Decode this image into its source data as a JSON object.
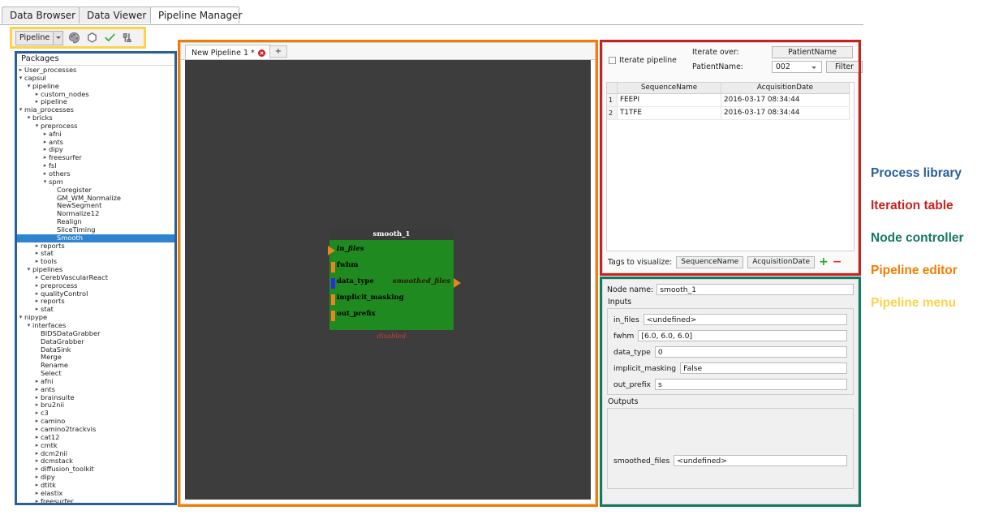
{
  "window": {
    "main_tabs": [
      {
        "label": "Data Browser",
        "active": false
      },
      {
        "label": "Data Viewer",
        "active": false
      },
      {
        "label": "Pipeline Manager",
        "active": true
      }
    ]
  },
  "pipeline_menu": {
    "combo_label": "Pipeline",
    "icons": [
      "palette-icon",
      "node-hexagon-icon",
      "checkmark-icon",
      "initialize-tool-icon"
    ]
  },
  "process_library": {
    "header": "Packages",
    "tree": [
      {
        "label": "User_processes",
        "depth": 0,
        "twisty": "collapsed"
      },
      {
        "label": "capsul",
        "depth": 0,
        "twisty": "expanded"
      },
      {
        "label": "pipeline",
        "depth": 1,
        "twisty": "expanded"
      },
      {
        "label": "custom_nodes",
        "depth": 2,
        "twisty": "collapsed"
      },
      {
        "label": "pipeline",
        "depth": 2,
        "twisty": "collapsed"
      },
      {
        "label": "mia_processes",
        "depth": 0,
        "twisty": "expanded"
      },
      {
        "label": "bricks",
        "depth": 1,
        "twisty": "expanded"
      },
      {
        "label": "preprocess",
        "depth": 2,
        "twisty": "expanded"
      },
      {
        "label": "afni",
        "depth": 3,
        "twisty": "collapsed"
      },
      {
        "label": "ants",
        "depth": 3,
        "twisty": "collapsed"
      },
      {
        "label": "dipy",
        "depth": 3,
        "twisty": "collapsed"
      },
      {
        "label": "freesurfer",
        "depth": 3,
        "twisty": "collapsed"
      },
      {
        "label": "fsl",
        "depth": 3,
        "twisty": "collapsed"
      },
      {
        "label": "others",
        "depth": 3,
        "twisty": "collapsed"
      },
      {
        "label": "spm",
        "depth": 3,
        "twisty": "expanded"
      },
      {
        "label": "Coregister",
        "depth": 4,
        "twisty": "none"
      },
      {
        "label": "GM_WM_Normalize",
        "depth": 4,
        "twisty": "none"
      },
      {
        "label": "NewSegment",
        "depth": 4,
        "twisty": "none"
      },
      {
        "label": "Normalize12",
        "depth": 4,
        "twisty": "none"
      },
      {
        "label": "Realign",
        "depth": 4,
        "twisty": "none"
      },
      {
        "label": "SliceTiming",
        "depth": 4,
        "twisty": "none"
      },
      {
        "label": "Smooth",
        "depth": 4,
        "twisty": "none",
        "selected": true
      },
      {
        "label": "reports",
        "depth": 2,
        "twisty": "collapsed"
      },
      {
        "label": "stat",
        "depth": 2,
        "twisty": "collapsed"
      },
      {
        "label": "tools",
        "depth": 2,
        "twisty": "collapsed"
      },
      {
        "label": "pipelines",
        "depth": 1,
        "twisty": "expanded"
      },
      {
        "label": "CerebVascularReact",
        "depth": 2,
        "twisty": "collapsed"
      },
      {
        "label": "preprocess",
        "depth": 2,
        "twisty": "collapsed"
      },
      {
        "label": "qualityControl",
        "depth": 2,
        "twisty": "collapsed"
      },
      {
        "label": "reports",
        "depth": 2,
        "twisty": "collapsed"
      },
      {
        "label": "stat",
        "depth": 2,
        "twisty": "collapsed"
      },
      {
        "label": "nipype",
        "depth": 0,
        "twisty": "expanded"
      },
      {
        "label": "interfaces",
        "depth": 1,
        "twisty": "expanded"
      },
      {
        "label": "BIDSDataGrabber",
        "depth": 2,
        "twisty": "none"
      },
      {
        "label": "DataGrabber",
        "depth": 2,
        "twisty": "none"
      },
      {
        "label": "DataSink",
        "depth": 2,
        "twisty": "none"
      },
      {
        "label": "Merge",
        "depth": 2,
        "twisty": "none"
      },
      {
        "label": "Rename",
        "depth": 2,
        "twisty": "none"
      },
      {
        "label": "Select",
        "depth": 2,
        "twisty": "none"
      },
      {
        "label": "afni",
        "depth": 2,
        "twisty": "collapsed"
      },
      {
        "label": "ants",
        "depth": 2,
        "twisty": "collapsed"
      },
      {
        "label": "brainsuite",
        "depth": 2,
        "twisty": "collapsed"
      },
      {
        "label": "bru2nii",
        "depth": 2,
        "twisty": "collapsed"
      },
      {
        "label": "c3",
        "depth": 2,
        "twisty": "collapsed"
      },
      {
        "label": "camino",
        "depth": 2,
        "twisty": "collapsed"
      },
      {
        "label": "camino2trackvis",
        "depth": 2,
        "twisty": "collapsed"
      },
      {
        "label": "cat12",
        "depth": 2,
        "twisty": "collapsed"
      },
      {
        "label": "cmtk",
        "depth": 2,
        "twisty": "collapsed"
      },
      {
        "label": "dcm2nii",
        "depth": 2,
        "twisty": "collapsed"
      },
      {
        "label": "dcmstack",
        "depth": 2,
        "twisty": "collapsed"
      },
      {
        "label": "diffusion_toolkit",
        "depth": 2,
        "twisty": "collapsed"
      },
      {
        "label": "dipy",
        "depth": 2,
        "twisty": "collapsed"
      },
      {
        "label": "dtitk",
        "depth": 2,
        "twisty": "collapsed"
      },
      {
        "label": "elastix",
        "depth": 2,
        "twisty": "collapsed"
      },
      {
        "label": "freesurfer",
        "depth": 2,
        "twisty": "collapsed"
      }
    ]
  },
  "pipeline_editor": {
    "tab_label": "New Pipeline 1 *",
    "add_tab_label": "+",
    "node": {
      "title": "smooth_1",
      "footer": "disabled",
      "inputs": [
        {
          "name": "in_files",
          "plug": "triangle",
          "color": "orange",
          "italic": true
        },
        {
          "name": "fwhm",
          "plug": "square",
          "color": "orange",
          "italic": false
        },
        {
          "name": "data_type",
          "plug": "square",
          "color": "blue",
          "italic": false
        },
        {
          "name": "implicit_masking",
          "plug": "square",
          "color": "orange",
          "italic": false
        },
        {
          "name": "out_prefix",
          "plug": "square",
          "color": "orange",
          "italic": false
        }
      ],
      "outputs": [
        {
          "name": "smoothed_files",
          "plug": "triangle",
          "color": "orange"
        }
      ]
    }
  },
  "iteration_table": {
    "checkbox_label": "Iterate pipeline",
    "iterate_over_label": "Iterate over:",
    "patient_name_label": "PatientName:",
    "iterate_over_value": "PatientName",
    "patient_name_value": "002",
    "filter_button": "Filter",
    "columns": [
      "SequenceName",
      "AcquisitionDate"
    ],
    "rows": [
      {
        "index": "1",
        "SequenceName": "FEEPI",
        "AcquisitionDate": "2016-03-17 08:34:44"
      },
      {
        "index": "2",
        "SequenceName": "T1TFE",
        "AcquisitionDate": "2016-03-17 08:34:44"
      }
    ],
    "tags_label": "Tags to visualize:",
    "tags": [
      "SequenceName",
      "AcquisitionDate"
    ],
    "add_symbol": "+",
    "remove_symbol": "−"
  },
  "node_controller": {
    "node_name_label": "Node name:",
    "node_name_value": "smooth_1",
    "inputs_title": "Inputs",
    "inputs": [
      {
        "name": "in_files",
        "value": "<undefined>"
      },
      {
        "name": "fwhm",
        "value": "[6.0, 6.0, 6.0]"
      },
      {
        "name": "data_type",
        "value": "0"
      },
      {
        "name": "implicit_masking",
        "value": "False"
      },
      {
        "name": "out_prefix",
        "value": "s"
      }
    ],
    "outputs_title": "Outputs",
    "outputs": [
      {
        "name": "smoothed_files",
        "value": "<undefined>"
      }
    ]
  },
  "legend": [
    {
      "label": "Process library",
      "color": "#2a6099"
    },
    {
      "label": "Iteration table",
      "color": "#c9211e"
    },
    {
      "label": "Node controller",
      "color": "#137a5f"
    },
    {
      "label": "Pipeline editor",
      "color": "#f57c00"
    },
    {
      "label": "Pipeline menu",
      "color": "#fcd34a"
    }
  ],
  "frames": {
    "process_library": "#2a6099",
    "iteration_table": "#c9211e",
    "node_controller": "#137a5f",
    "pipeline_editor": "#f57c00",
    "pipeline_menu": "#fcd34a"
  }
}
